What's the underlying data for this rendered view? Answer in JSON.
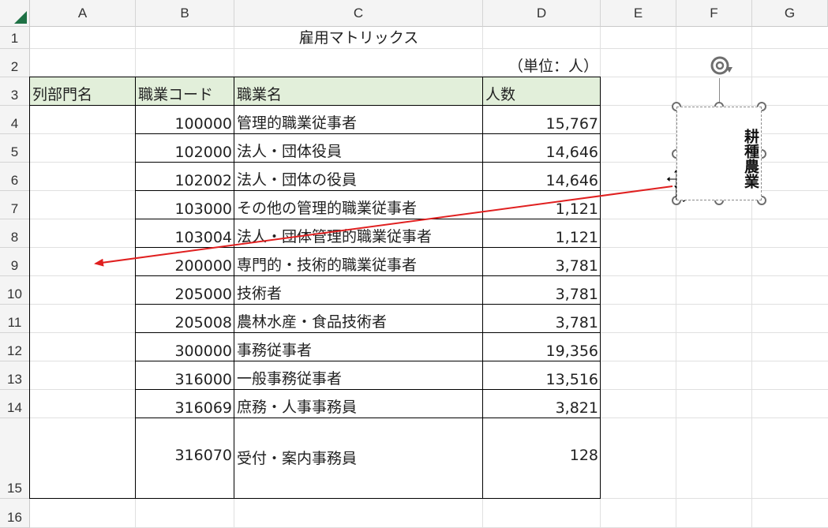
{
  "columns": [
    "A",
    "B",
    "C",
    "D",
    "E",
    "F",
    "G"
  ],
  "rows": [
    "1",
    "2",
    "3",
    "4",
    "5",
    "6",
    "7",
    "8",
    "9",
    "10",
    "11",
    "12",
    "13",
    "14",
    "15",
    "16"
  ],
  "title": "雇用マトリックス",
  "unit": "（単位：人）",
  "headers": {
    "dept": "列部門名",
    "code": "職業コード",
    "name": "職業名",
    "count": "人数"
  },
  "table": [
    {
      "code": "100000",
      "name": "管理的職業従事者",
      "count": "15,767"
    },
    {
      "code": "102000",
      "name": "法人・団体役員",
      "count": "14,646"
    },
    {
      "code": "102002",
      "name": "法人・団体の役員",
      "count": "14,646"
    },
    {
      "code": "103000",
      "name": "その他の管理的職業従事者",
      "count": "1,121"
    },
    {
      "code": "103004",
      "name": "法人・団体管理的職業従事者",
      "count": "1,121"
    },
    {
      "code": "200000",
      "name": "専門的・技術的職業従事者",
      "count": "3,781"
    },
    {
      "code": "205000",
      "name": "技術者",
      "count": "3,781"
    },
    {
      "code": "205008",
      "name": "農林水産・食品技術者",
      "count": "3,781"
    },
    {
      "code": "300000",
      "name": "事務従事者",
      "count": "19,356"
    },
    {
      "code": "316000",
      "name": "一般事務従事者",
      "count": "13,516"
    },
    {
      "code": "316069",
      "name": "庶務・人事事務員",
      "count": "3,821"
    },
    {
      "code": "316070",
      "name": "受付・案内事務員",
      "count": "128"
    }
  ],
  "shape": {
    "text": "耕種農業"
  },
  "colors": {
    "header_fill": "#e2efda",
    "arrow": "#e02020",
    "excel_green": "#1e7145"
  },
  "icons": [
    "rotate-handle-icon",
    "move-cursor-icon",
    "select-all-triangle-icon"
  ]
}
